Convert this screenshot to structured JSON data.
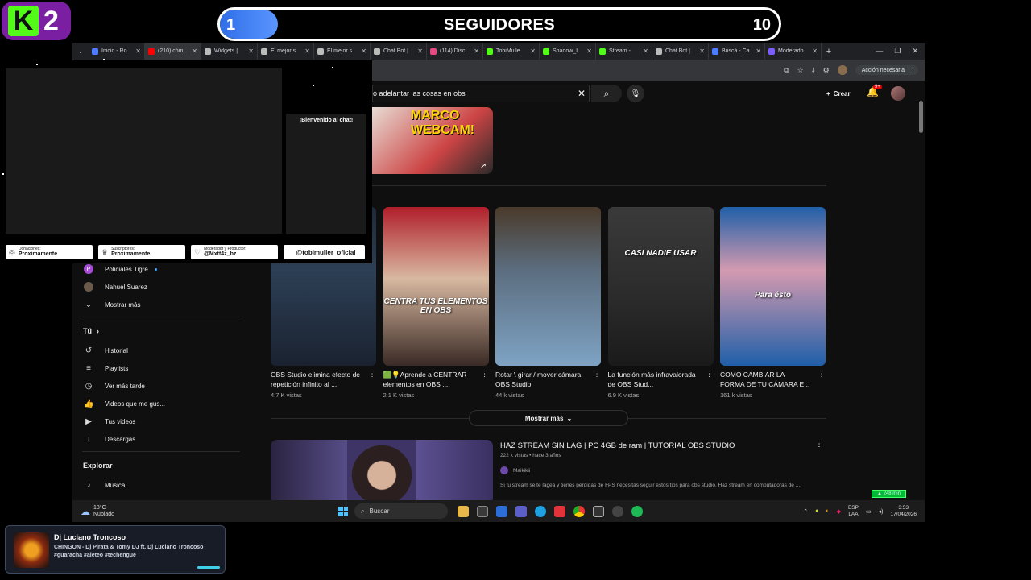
{
  "overlay": {
    "logo_letter": "K",
    "logo_number": "2",
    "goal": {
      "current": "1",
      "title": "SEGUIDORES",
      "target": "10",
      "progress": 0.1
    }
  },
  "browser": {
    "tabs": [
      {
        "title": "Inicio - Ro",
        "color": "#4a7dff",
        "active": false
      },
      {
        "title": "(210) cóm",
        "color": "#ff0000",
        "active": true
      },
      {
        "title": "Widgets |",
        "color": "#bbbbbb",
        "active": false
      },
      {
        "title": "El mejor s",
        "color": "#bbbbbb",
        "active": false
      },
      {
        "title": "El mejor s",
        "color": "#bbbbbb",
        "active": false
      },
      {
        "title": "Chat Bot |",
        "color": "#bbbbbb",
        "active": false
      },
      {
        "title": "(114) Disc",
        "color": "#e64980",
        "active": false
      },
      {
        "title": "TobiMulle",
        "color": "#53fc18",
        "active": false
      },
      {
        "title": "Shadow_L",
        "color": "#53fc18",
        "active": false
      },
      {
        "title": "Stream - ",
        "color": "#53fc18",
        "active": false
      },
      {
        "title": "Chat Bot |",
        "color": "#bbbbbb",
        "active": false
      },
      {
        "title": "Buscá - Ca",
        "color": "#4a7dff",
        "active": false
      },
      {
        "title": "Moderado",
        "color": "#7c5cff",
        "active": false
      }
    ],
    "action_needed": "Acción necesaria"
  },
  "youtube": {
    "search_query": "o adelantar las cosas en obs",
    "create_label": "Crear",
    "notif_count": "9+",
    "top_thumb_title": "MARCO WEBCAM!",
    "sidebar": {
      "channels": [
        {
          "name": "Policiales Tigre",
          "initial": "P",
          "color": "#a64bd6",
          "live": true
        },
        {
          "name": "Nahuel Suarez",
          "initial": "",
          "color": "#6b5a4a",
          "live": false
        }
      ],
      "show_more": "Mostrar más",
      "you_heading": "Tú",
      "you_items": [
        {
          "label": "Historial",
          "icon": "history-icon",
          "glyph": "↺"
        },
        {
          "label": "Playlists",
          "icon": "playlist-icon",
          "glyph": "≡"
        },
        {
          "label": "Ver más tarde",
          "icon": "clock-icon",
          "glyph": "◷"
        },
        {
          "label": "Videos que me gus...",
          "icon": "thumb-up-icon",
          "glyph": "👍"
        },
        {
          "label": "Tus videos",
          "icon": "video-icon",
          "glyph": "▶"
        },
        {
          "label": "Descargas",
          "icon": "download-icon",
          "glyph": "↓"
        }
      ],
      "explore_heading": "Explorar",
      "explore_items": [
        {
          "label": "Música",
          "icon": "music-icon",
          "glyph": "♪"
        }
      ]
    },
    "shorts": [
      {
        "title": "OBS Studio elimina efecto de repetición infinito al ...",
        "views": "4.7 K vistas",
        "overlay": "",
        "bg": "linear-gradient(180deg,#1e2a3a,#2d3f55 40%,#1a2230)"
      },
      {
        "title": "🟩💡Aprende a CENTRAR elementos en OBS ...",
        "views": "2.1 K vistas",
        "overlay": "CENTRA TUS ELEMENTOS EN OBS",
        "bg": "linear-gradient(180deg,#b01e2a,#d8b8a0 45%,#3a2a25)"
      },
      {
        "title": "Rotar \\ girar / mover cámara OBS Studio",
        "views": "44 k vistas",
        "overlay": "",
        "bg": "linear-gradient(180deg,#4a3a2a,#5c6e80 40%,#7ea3c4)"
      },
      {
        "title": "La función más infravalorada de OBS Stud...",
        "views": "6.9 K vistas",
        "overlay": "CASI NADIE USAR",
        "bg": "linear-gradient(180deg,#3a3a3a,#2a2a2a 60%,#1a1a1a)"
      },
      {
        "title": "COMO CAMBIAR LA FORMA DE TU CÁMARA E...",
        "views": "161 k vistas",
        "overlay": "Para ésto",
        "bg": "linear-gradient(180deg,#1f5fa8,#d49ab0 40%,#1f5fa8)"
      }
    ],
    "show_more_label": "Mostrar más",
    "video": {
      "title": "HAZ STREAM SIN LAG | PC 4GB de ram | TUTORIAL OBS STUDIO",
      "meta": "222 k vistas • hace 3 años",
      "channel": "Maikikii",
      "description": "Si tu stream se te lagea y tienes perdidas de FPS necesitas seguir estos tips para obs studio. Haz stream en computadoras de ..."
    },
    "badge": "▲ 248 min"
  },
  "taskbar": {
    "temp": "18°C",
    "weather": "Nublado",
    "search": "Buscar",
    "lang1": "ESP",
    "lang2": "LAA",
    "time": "3:53",
    "date": "17/04/2026"
  },
  "stream_panel": {
    "chat_welcome": "¡Bienvenido al chat!",
    "cards": [
      {
        "label": "Donaciones:",
        "value": "Proximamente",
        "icon": "coin-icon",
        "glyph": "◎"
      },
      {
        "label": "Suscriptores:",
        "value": "Proximamente",
        "icon": "crown-icon",
        "glyph": "♛"
      },
      {
        "label": "Moderador y Productor:",
        "value": "@Mxtt4z_bz",
        "icon": "heart-icon",
        "glyph": "♡"
      }
    ],
    "handle": "@tobimuller_oficial"
  },
  "now_playing": {
    "artist": "Dj Luciano Troncoso",
    "track": "CHINGON - Dj Pirata & Tomy DJ ft. Dj Luciano Troncoso",
    "tags": "#guaracha #aleteo #techengue",
    "progress": 0.1
  }
}
